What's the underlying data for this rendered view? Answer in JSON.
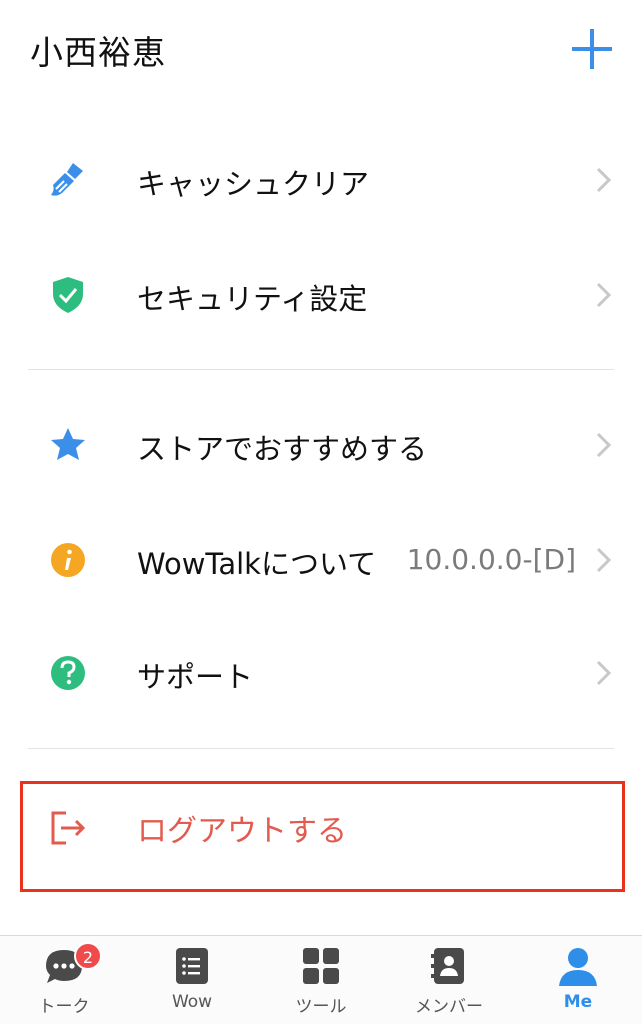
{
  "header": {
    "title": "小西裕恵",
    "add_icon": "plus-icon"
  },
  "menu": {
    "items": [
      {
        "id": "cache",
        "label": "キャッシュクリア",
        "icon": "broom-icon",
        "icon_color": "#3b8fe8"
      },
      {
        "id": "security",
        "label": "セキュリティ設定",
        "icon": "shield-check-icon",
        "icon_color": "#2dbd7e"
      },
      {
        "id": "store",
        "label": "ストアでおすすめする",
        "icon": "star-icon",
        "icon_color": "#3b8fe8"
      },
      {
        "id": "about",
        "label": "WowTalkについて",
        "value": "10.0.0.0-[D]",
        "icon": "info-icon",
        "icon_color": "#f5a623"
      },
      {
        "id": "support",
        "label": "サポート",
        "icon": "question-icon",
        "icon_color": "#2dbd7e"
      }
    ],
    "logout": {
      "label": "ログアウトする",
      "icon": "logout-icon",
      "color": "#e25b4e"
    }
  },
  "tabbar": {
    "tabs": [
      {
        "label": "トーク",
        "icon": "chat-bubble-icon",
        "badge": "2"
      },
      {
        "label": "Wow",
        "icon": "list-icon"
      },
      {
        "label": "ツール",
        "icon": "grid-icon"
      },
      {
        "label": "メンバー",
        "icon": "contact-book-icon"
      },
      {
        "label": "Me",
        "icon": "person-icon",
        "active": true
      }
    ]
  },
  "colors": {
    "accent": "#2f8ee8",
    "highlight_border": "#e8321e",
    "badge": "#f04a4a"
  }
}
